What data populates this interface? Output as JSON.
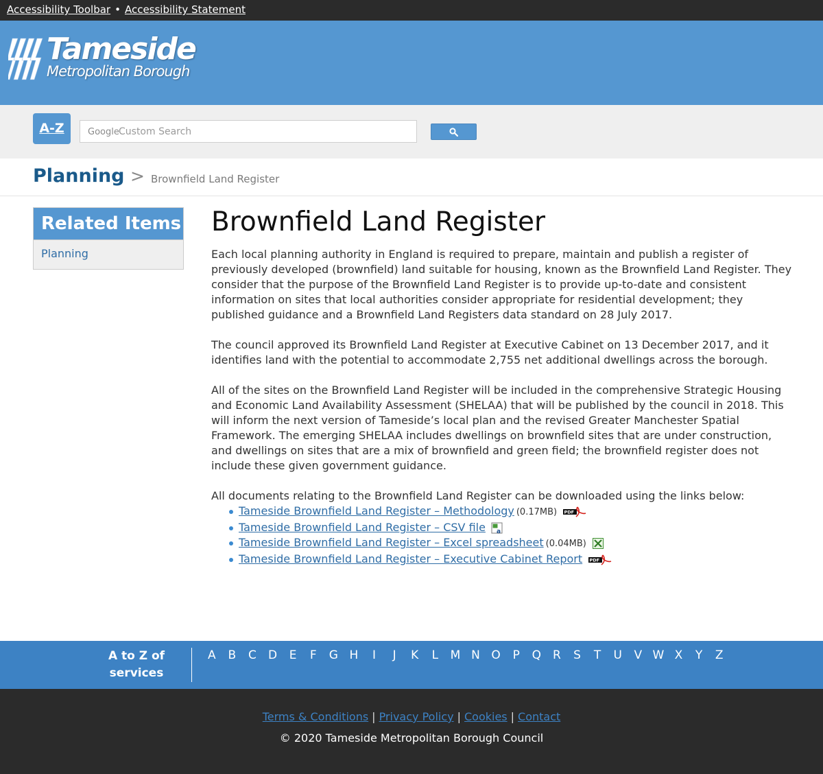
{
  "topbar": {
    "toolbar_link": "Accessibility Toolbar",
    "separator": "•",
    "statement_link": "Accessibility Statement"
  },
  "header": {
    "logo_title": "Tameside",
    "logo_subtitle": "Metropolitan Borough",
    "brand_color": "#5597d1"
  },
  "search": {
    "az_label": "A-Z",
    "google_mark": "Google",
    "placeholder": "Custom Search",
    "button_icon": "search-icon"
  },
  "breadcrumb": {
    "parent": "Planning",
    "separator": ">",
    "current": "Brownfield Land Register"
  },
  "sidebar": {
    "heading": "Related Items",
    "items": [
      {
        "label": "Planning"
      }
    ]
  },
  "main": {
    "title": "Brownfield Land Register",
    "paragraphs": [
      "Each local planning authority in England is required to prepare, maintain and publish a register of previously developed (brownfield) land suitable for housing, known as the Brownfield Land Register. They consider that the purpose of the Brownfield Land Register is to provide up-to-date and consistent information on sites that local authorities consider appropriate for residential development; they published guidance and a Brownfield Land Registers data standard on 28 July 2017.",
      "The council approved its Brownfield Land Register at Executive Cabinet on 13 December 2017, and it identifies land with the potential to accommodate 2,755 net additional dwellings across the borough.",
      "All of the sites on the Brownfield Land Register will be included in the comprehensive Strategic Housing and Economic Land Availability Assessment (SHELAA) that will be published by the council in 2018. This will inform the next version of Tameside’s local plan and the revised Greater Manchester Spatial Framework. The emerging SHELAA includes dwellings on brownfield sites that are under construction, and dwellings on sites that are a mix of brownfield and green field; the brownfield register does not include these given government guidance.",
      "All documents relating to the Brownfield Land Register can be downloaded using the links below:"
    ],
    "documents": [
      {
        "label": "Tameside Brownfield Land Register – Methodology",
        "size": "(0.17MB)",
        "icon": "pdf-icon"
      },
      {
        "label": "Tameside Brownfield Land Register – CSV file",
        "size": "",
        "icon": "csv-icon"
      },
      {
        "label": "Tameside Brownfield Land Register – Excel spreadsheet",
        "size": "(0.04MB)",
        "icon": "excel-icon"
      },
      {
        "label": "Tameside Brownfield Land Register – Executive Cabinet Report",
        "size": "",
        "icon": "pdf-icon"
      }
    ]
  },
  "az_footer": {
    "label": "A to Z of services",
    "letters": [
      "A",
      "B",
      "C",
      "D",
      "E",
      "F",
      "G",
      "H",
      "I",
      "J",
      "K",
      "L",
      "M",
      "N",
      "O",
      "P",
      "Q",
      "R",
      "S",
      "T",
      "U",
      "V",
      "W",
      "X",
      "Y",
      "Z"
    ]
  },
  "footer": {
    "links": [
      "Terms & Conditions",
      "Privacy Policy",
      "Cookies",
      "Contact"
    ],
    "separator": "|",
    "copyright": "© 2020 Tameside Metropolitan Borough Council"
  }
}
